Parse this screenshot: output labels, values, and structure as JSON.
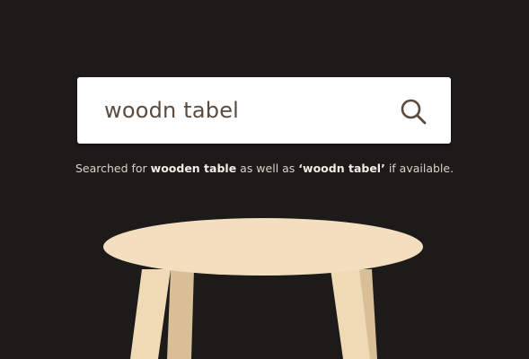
{
  "search": {
    "value": "woodn tabel",
    "icon": "search-icon"
  },
  "helper": {
    "prefix": "Searched for ",
    "corrected_term": "wooden table",
    "middle": " as well as ",
    "original_term": "‘woodn tabel’",
    "suffix": " if available."
  },
  "colors": {
    "background": "#1d1b1a",
    "search_text": "#5b4b3f",
    "table_top": "#f3dfc0",
    "table_leg": "#ecd3ad"
  },
  "illustration": {
    "icon": "table-illustration"
  }
}
